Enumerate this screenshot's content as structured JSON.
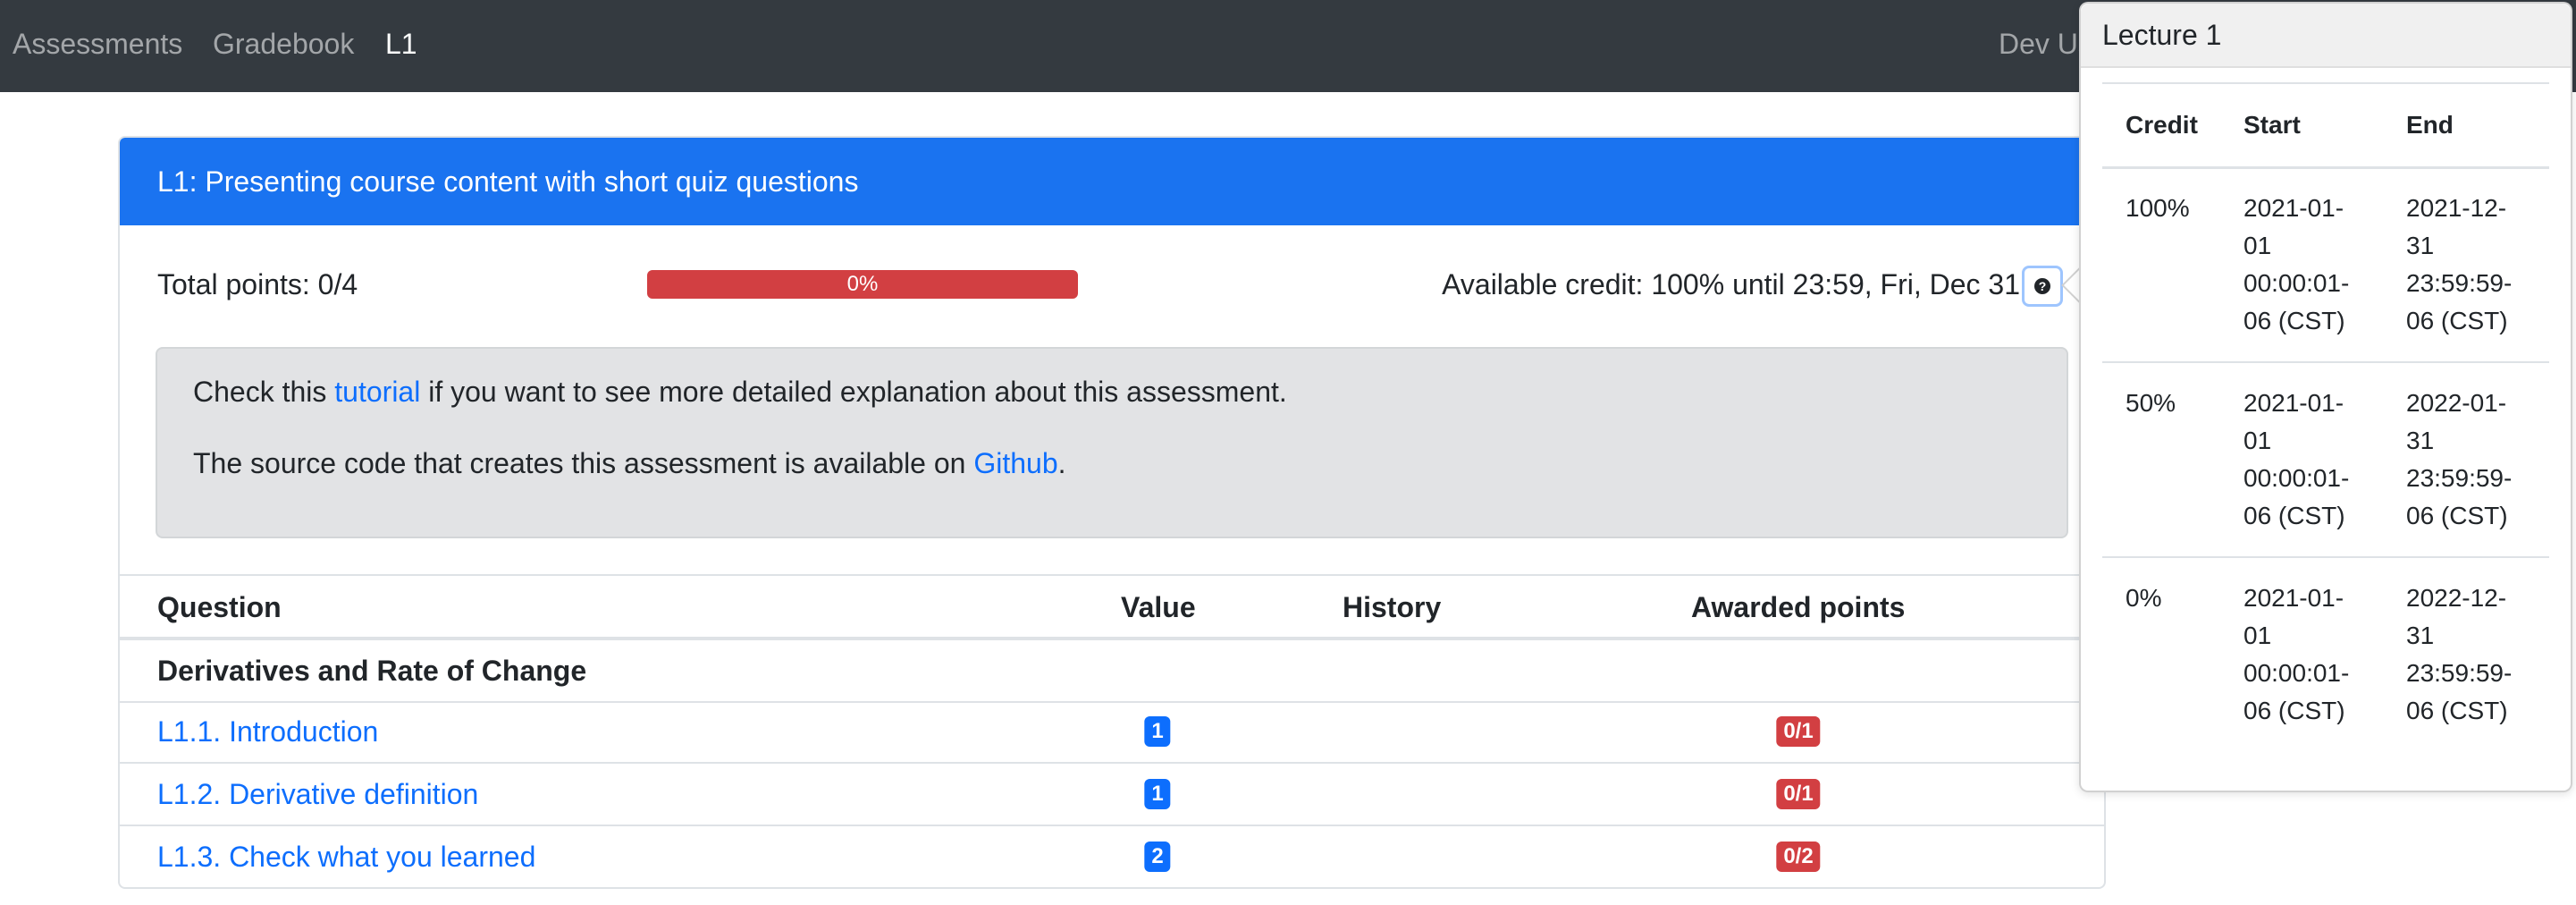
{
  "navbar": {
    "links": [
      "Assessments",
      "Gradebook",
      "L1"
    ],
    "user_label": "Dev User"
  },
  "assessment": {
    "title": "L1: Presenting course content with short quiz questions",
    "total_points": "Total points: 0/4",
    "progress_label": "0%",
    "progress_fraction": 0,
    "credit_text": "Available credit: 100% until 23:59, Fri, Dec 31",
    "help_icon_glyph": "?",
    "info": {
      "line1_prefix": "Check this ",
      "line1_link": "tutorial",
      "line1_suffix": " if you want to see more detailed explanation about this assessment.",
      "line2_prefix": "The source code that creates this assessment is available on ",
      "line2_link": "Github",
      "line2_suffix": "."
    }
  },
  "table": {
    "headers": {
      "question": "Question",
      "value": "Value",
      "history": "History",
      "awarded": "Awarded points"
    },
    "group": "Derivatives and Rate of Change",
    "rows": [
      {
        "question": "L1.1. Introduction",
        "value": "1",
        "awarded": "0/1"
      },
      {
        "question": "L1.2. Derivative definition",
        "value": "1",
        "awarded": "0/1"
      },
      {
        "question": "L1.3. Check what you learned",
        "value": "2",
        "awarded": "0/2"
      }
    ]
  },
  "popover": {
    "title": "Lecture 1",
    "headers": {
      "credit": "Credit",
      "start": "Start",
      "end": "End"
    },
    "rows": [
      {
        "credit": "100%",
        "start": [
          "2021-01-",
          "01",
          "00:00:01-",
          "06 (CST)"
        ],
        "end": [
          "2021-12-",
          "31",
          "23:59:59-",
          "06 (CST)"
        ]
      },
      {
        "credit": "50%",
        "start": [
          "2021-01-",
          "01",
          "00:00:01-",
          "06 (CST)"
        ],
        "end": [
          "2022-01-",
          "31",
          "23:59:59-",
          "06 (CST)"
        ]
      },
      {
        "credit": "0%",
        "start": [
          "2021-01-",
          "01",
          "00:00:01-",
          "06 (CST)"
        ],
        "end": [
          "2022-12-",
          "31",
          "23:59:59-",
          "06 (CST)"
        ]
      }
    ]
  },
  "colors": {
    "navbar_bg": "#343a40",
    "header_blue": "#1a73f0",
    "danger_red": "#d23f42",
    "link_blue": "#0d6efd",
    "info_bg": "#e2e3e5"
  }
}
